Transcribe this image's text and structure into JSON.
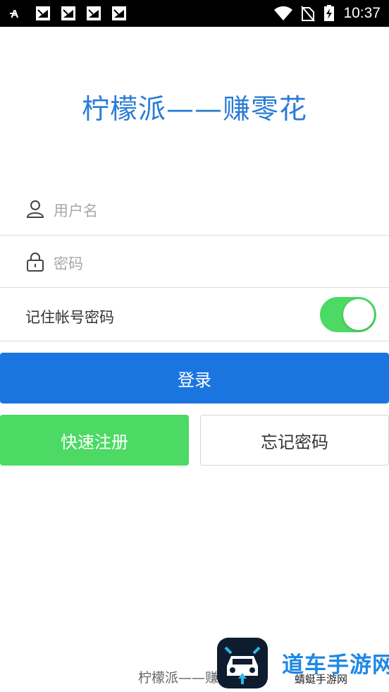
{
  "status_bar": {
    "time": "10:37",
    "left_icons": [
      "font-a-icon",
      "notification-app-icon",
      "notification-app-icon",
      "notification-app-icon",
      "notification-app-icon"
    ],
    "right_icons": [
      "wifi-icon",
      "no-sim-icon",
      "battery-charging-icon"
    ]
  },
  "app": {
    "title": "柠檬派——赚零花"
  },
  "form": {
    "username_placeholder": "用户名",
    "password_placeholder": "密码",
    "remember_label": "记住帐号密码",
    "remember_on": true,
    "toggle_color": "#4cd964"
  },
  "buttons": {
    "login": "登录",
    "register": "快速注册",
    "forgot": "忘记密码"
  },
  "colors": {
    "accent": "#1a75e0",
    "title": "#2a7bd6",
    "success": "#4cd964"
  },
  "footer": {
    "text": "柠檬派——赚"
  },
  "watermark": {
    "brand": "道车手游网",
    "sub": "蜻蜓手游网"
  }
}
